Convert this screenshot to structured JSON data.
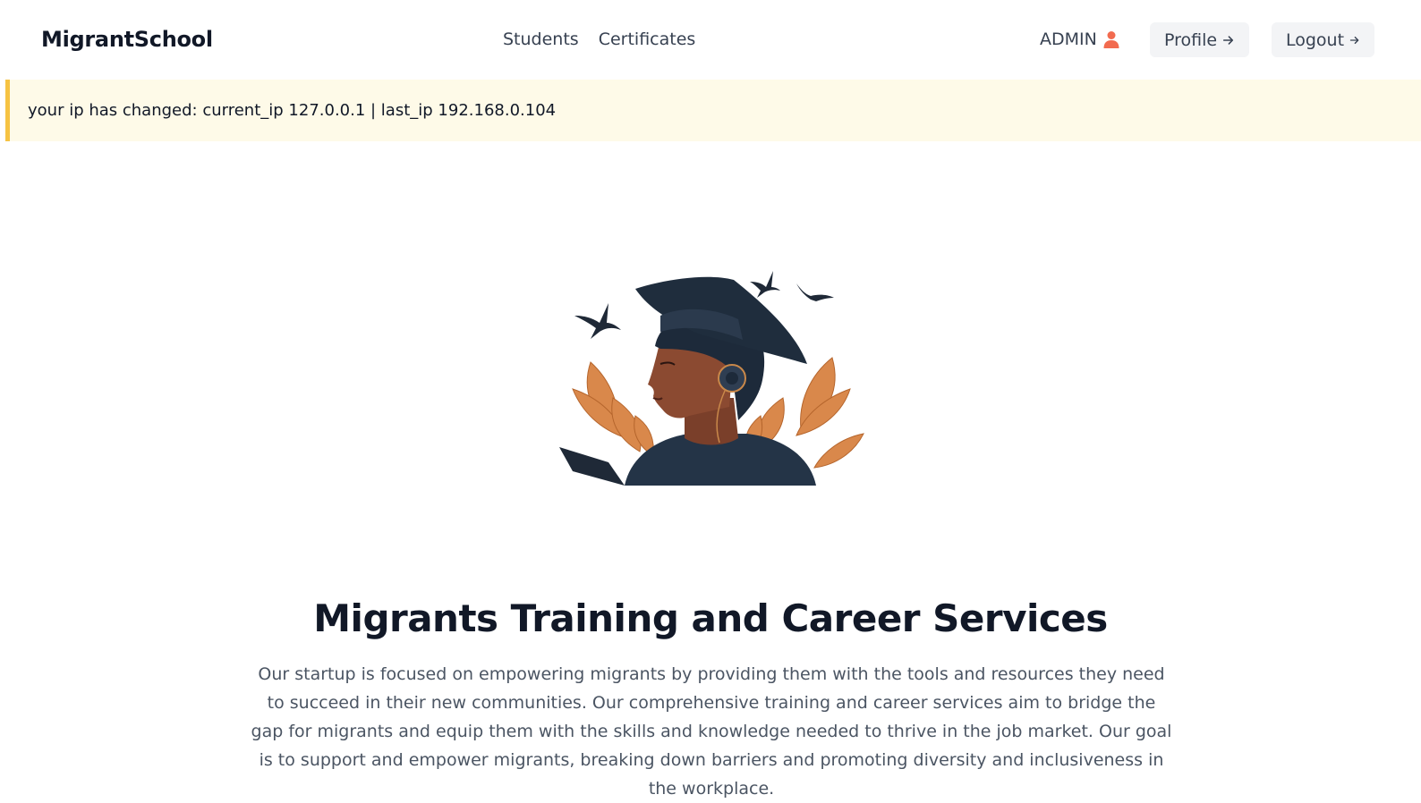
{
  "header": {
    "brand": "MigrantSchool",
    "nav": [
      {
        "label": "Students"
      },
      {
        "label": "Certificates"
      }
    ],
    "user": {
      "name": "ADMIN",
      "icon": "user-icon",
      "icon_color": "#f26b4f"
    },
    "profile_label": "Profile",
    "logout_label": "Logout",
    "arrow_icon": "arrow-right-icon"
  },
  "alert": {
    "message": "your ip has changed: current_ip 127.0.0.1 | last_ip 192.168.0.104",
    "background": "#fefae8",
    "accent": "#f6c343"
  },
  "hero": {
    "illustration": "graduate-student-illustration",
    "title": "Migrants Training and Career Services",
    "description": "Our startup is focused on empowering migrants by providing them with the tools and resources they need to succeed in their new communities. Our comprehensive training and career services aim to bridge the gap for migrants and equip them with the skills and knowledge needed to thrive in the job market. Our goal is to support and empower migrants, breaking down barriers and promoting diversity and inclusiveness in the workplace."
  }
}
